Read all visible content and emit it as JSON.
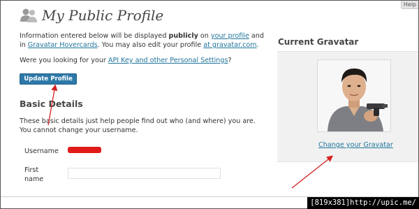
{
  "help_tab": "Help",
  "page": {
    "title": "My Public Profile"
  },
  "info": {
    "part1": "Information entered below will be displayed ",
    "part2_bold": "publicly",
    "part3": " on ",
    "link_your_profile": "your profile",
    "part4": " and in ",
    "link_hovercards": "Gravatar Hovercards",
    "part5": ". You may also edit your profile ",
    "link_gravatar": "at gravatar.com",
    "part6": "."
  },
  "api_prompt": {
    "before": "Were you looking for your ",
    "link": "API Key and other Personal Settings",
    "after": "?"
  },
  "buttons": {
    "update_profile": "Update Profile"
  },
  "basic_details": {
    "heading": "Basic Details",
    "description": "These basic details just help people find out who (and where) you are. You cannot change your username.",
    "username_label": "Username",
    "first_name_label_1": "First",
    "first_name_label_2": "name",
    "first_name_value": ""
  },
  "gravatar": {
    "heading": "Current Gravatar",
    "change_link": "Change your Gravatar"
  },
  "watermark": "[819x381]http://upic.me/",
  "colors": {
    "link": "#21759b",
    "button": "#2e79a8",
    "annotation_arrow": "#d42020",
    "redaction": "#e11a1a"
  }
}
